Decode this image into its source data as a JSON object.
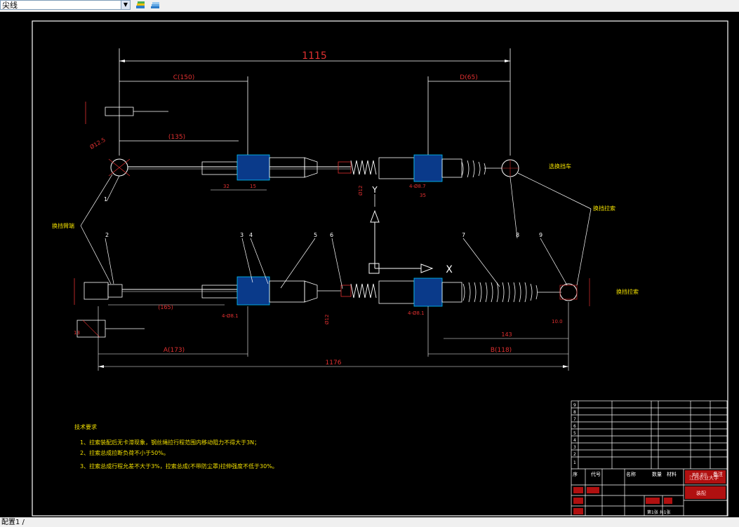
{
  "toolbar": {
    "layer_value": "尖线",
    "icons": [
      "layer-manager-icon",
      "layer-states-icon"
    ]
  },
  "drawing": {
    "dimensions": {
      "overall_top": "1115",
      "top_left_c": "C(150)",
      "top_left_135": "(135)",
      "top_right_d": "D(65)",
      "bottom_left_165": "(165)",
      "bottom_a": "A(173)",
      "bottom_overall": "1176",
      "bottom_b": "B(118)",
      "bottom_143": "143"
    },
    "labels": {
      "shift_lever_end": "换挡拉索",
      "select_lever_end": "选换挡车",
      "bottom_right": "换挡拉索",
      "left_callout": "换挡臂端",
      "axis_y": "Y",
      "axis_x": "X"
    },
    "balloons": [
      "1",
      "2",
      "3",
      "4",
      "5",
      "6",
      "7",
      "8",
      "9"
    ],
    "tech_requirements": {
      "title": "技术要求",
      "items": [
        "1、拉索装配后无卡滞现象，钢丝绳拉行程范围内移动阻力不得大于3N；",
        "2、拉索总成拉断负荷不小于50%。",
        "3、拉索总成行程允差不大于3%，拉索总成(不带防尘罩)拉伸强度不低于30%。"
      ]
    },
    "title_block": {
      "header_cols": [
        "序",
        "代号",
        "名称",
        "数量",
        "材料",
        "单件 总计",
        "备注"
      ],
      "school": "江西农业大学",
      "drawing_name": "装配",
      "sheet": "第1张 共1张"
    }
  },
  "status_bar": {
    "text": "配置1 /"
  }
}
